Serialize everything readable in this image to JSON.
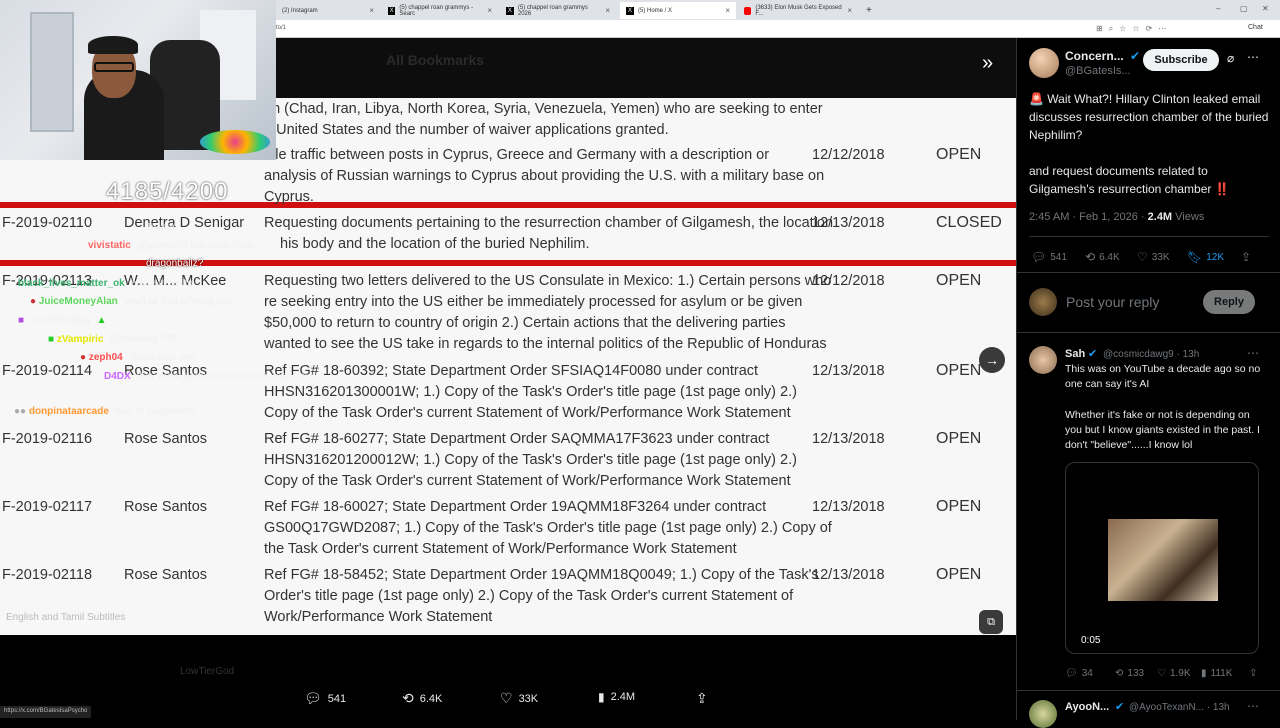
{
  "browser": {
    "tabs": [
      {
        "label": "(2) Instagram"
      },
      {
        "label": "(5) chappel roan grammys - Searc"
      },
      {
        "label": "(5) chappel roan grammys 2026"
      },
      {
        "label": "(5) Home / X"
      },
      {
        "label": "(3633) Elon Musk Gets Exposed F..."
      }
    ],
    "address": "to/1",
    "chat_label": "Chat"
  },
  "viewer": {
    "header_title": "All Bookmarks",
    "counter": "4185/4200",
    "caption": "English and Tamil Subtitles"
  },
  "document_rows": [
    {
      "id": "",
      "name": "",
      "desc1": "en (Chad, Iran, Libya, North Korea, Syria, Venezuela, Yemen) who are seeking to enter",
      "desc2": "e United States and the number of waiver applications granted.",
      "desc3": "",
      "date": "",
      "status": ""
    },
    {
      "id": "",
      "name": "",
      "desc1": "ible traffic between posts in Cyprus, Greece and Germany with a description or",
      "desc2": "analysis of Russian warnings to Cyprus about providing the U.S. with a military base on",
      "desc3": "Cyprus.",
      "date": "12/12/2018",
      "status": "OPEN"
    },
    {
      "id": "F-2019-02110",
      "name": "Denetra D Senigar",
      "desc1": "Requesting documents pertaining to the resurrection chamber of Gilgamesh, the location",
      "desc2": "his body and the location of the buried Nephilim.",
      "desc3": "",
      "date": "12/13/2018",
      "status": "CLOSED"
    },
    {
      "id": "F-2019-02113",
      "name": "W... M... McKee",
      "desc1": "Requesting two letters delivered to the US Consulate in Mexico: 1.) Certain persons who",
      "desc2": "re seeking entry into the US either be immediately processed for asylum or be given",
      "desc3": "$50,000 to return to country of origin 2.) Certain actions that the delivering parties",
      "desc4": "wanted to see the US take in regards to the internal politics of the Republic of Honduras",
      "date": "12/12/2018",
      "status": "OPEN"
    },
    {
      "id": "F-2019-02114",
      "name": "Rose Santos",
      "desc1": "Ref FG# 18-60392; State Department Order SFSIAQ14F0080 under contract",
      "desc2": "HHSN316201300001W; 1.) Copy of the Task's Order's title page (1st page only) 2.)",
      "desc3": "Copy of the Task Order's current Statement of Work/Performance Work Statement",
      "date": "12/13/2018",
      "status": "OPEN"
    },
    {
      "id": "F-2019-02116",
      "name": "Rose Santos",
      "desc1": "Ref FG# 18-60277; State Department Order SAQMMA17F3623 under contract",
      "desc2": "HHSN316201200012W; 1.) Copy of the Task's Order's title page (1st page only) 2.)",
      "desc3": "Copy of the Task Order's current Statement of Work/Performance Work Statement",
      "date": "12/13/2018",
      "status": "OPEN"
    },
    {
      "id": "F-2019-02117",
      "name": "Rose Santos",
      "desc1": "Ref FG# 18-60027; State Department Order 19AQMM18F3264 under contract",
      "desc2": "GS00Q17GWD2087; 1.) Copy of the Task's Order's title page (1st page only) 2.) Copy of",
      "desc3": "the Task Order's current Statement of Work/Performance Work Statement",
      "date": "12/13/2018",
      "status": "OPEN"
    },
    {
      "id": "F-2019-02118",
      "name": "Rose Santos",
      "desc1": "Ref FG# 18-58452; State Department Order 19AQMM18Q0049; 1.) Copy of the Task's",
      "desc2": "Order's title page (1st page only) 2.) Copy of the Task Order's current Statement of",
      "desc3": "Work/Performance Work Statement",
      "date": "12/13/2018",
      "status": "OPEN"
    }
  ],
  "chat": [
    {
      "user": "",
      "msg": "Twitter",
      "color": "#ffffff"
    },
    {
      "user": "vivistatic",
      "msg": "gilgamesh? the dude from",
      "color": "#ff6666"
    },
    {
      "user": "",
      "msg": "dragonballz?",
      "color": "#ffffff"
    },
    {
      "user": "black_lives_matter_ok",
      "msg": "educate us lfg",
      "color": "#3cb371"
    },
    {
      "user": "JuiceMoneyAlan",
      "msg": "yeah all that offering shit",
      "color": "#5cd65c"
    },
    {
      "user": "",
      "msg": "recelebrating",
      "color": "#cccccc"
    },
    {
      "user": "zVampiric",
      "msg": "@vivistatic ???",
      "color": "#e6e600"
    },
    {
      "user": "zeph04",
      "msg": "@vivistatic yes",
      "color": "#ff4d4d"
    },
    {
      "user": "D4DX",
      "msg": "they arent gonna ressurrect a nephilim",
      "color": "#cc66ff"
    },
    {
      "user": "donpinataarcade",
      "msg": "epic of Gilgamesh",
      "color": "#ff9933"
    }
  ],
  "actions": {
    "replies": "541",
    "reposts": "6.4K",
    "likes": "33K",
    "views": "2.4M"
  },
  "status_url": "https://x.com/BGatesIsaPsycho",
  "bottom_user": "LowTierGod",
  "post": {
    "name": "Concern...",
    "handle": "@BGatesIs...",
    "subscribe": "Subscribe",
    "text1": "🚨 Wait What?! Hillary Clinton leaked email discusses resurrection chamber of the buried Nephilim?",
    "text2": "and request documents related to Gilgamesh's resurrection chamber ‼️",
    "time": "2:45 AM · Feb 1, 2026 ·",
    "views": "2.4M",
    "views_label": "Views",
    "stats": {
      "replies": "541",
      "reposts": "6.4K",
      "likes": "33K",
      "bookmarks": "12K"
    },
    "reply_placeholder": "Post your reply",
    "reply_button": "Reply"
  },
  "reply1": {
    "name": "Sah",
    "handle": "@cosmicdawg9 · 13h",
    "text1": "This was on YouTube a decade ago so no one can say it's AI",
    "text2": "Whether it's fake or not is depending on you but I know giants existed in the past. I don't \"believe\"......I know lol",
    "duration": "0:05",
    "stats": {
      "replies": "34",
      "reposts": "133",
      "likes": "1.9K",
      "views": "111K"
    }
  },
  "reply2": {
    "name": "AyooN...",
    "handle": "@AyooTexanN... · 13h"
  },
  "colors": {
    "accent": "#1d9bf0",
    "red": "#d01010",
    "verified": "#1d9bf0"
  }
}
